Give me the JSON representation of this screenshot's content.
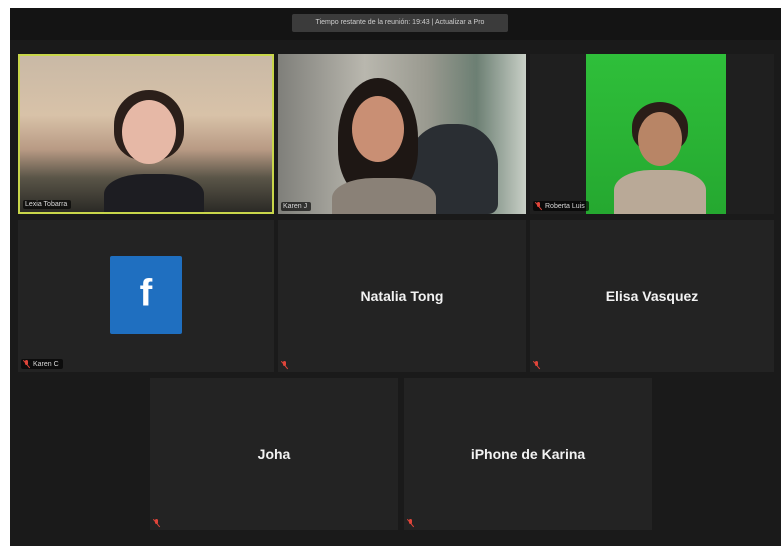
{
  "meeting": {
    "banner_text": "Tiempo restante de la reunión: 19:43 | Actualizar a Pro"
  },
  "colors": {
    "active_speaker_border": "#c8d64a",
    "tile_bg": "#232323",
    "muted_mic": "#e0453a",
    "facebook_blue": "#1f6fc0"
  },
  "participants": [
    {
      "display_name": "",
      "label": "Lexia Tobarra",
      "video": true,
      "active": true,
      "muted": false
    },
    {
      "display_name": "",
      "label": "Karen J",
      "video": true,
      "active": false,
      "muted": false
    },
    {
      "display_name": "",
      "label": "Roberta Luis",
      "video": true,
      "active": false,
      "muted": true
    },
    {
      "display_name": "",
      "label": "Karen C",
      "video": false,
      "avatar": "facebook-icon",
      "avatar_glyph": "f",
      "muted": true
    },
    {
      "display_name": "Natalia Tong",
      "label": "",
      "video": false,
      "muted": true
    },
    {
      "display_name": "Elisa Vasquez",
      "label": "",
      "video": false,
      "muted": true
    },
    {
      "display_name": "Joha",
      "label": "",
      "video": false,
      "muted": true
    },
    {
      "display_name": "iPhone de Karina",
      "label": "",
      "video": false,
      "muted": true
    }
  ]
}
